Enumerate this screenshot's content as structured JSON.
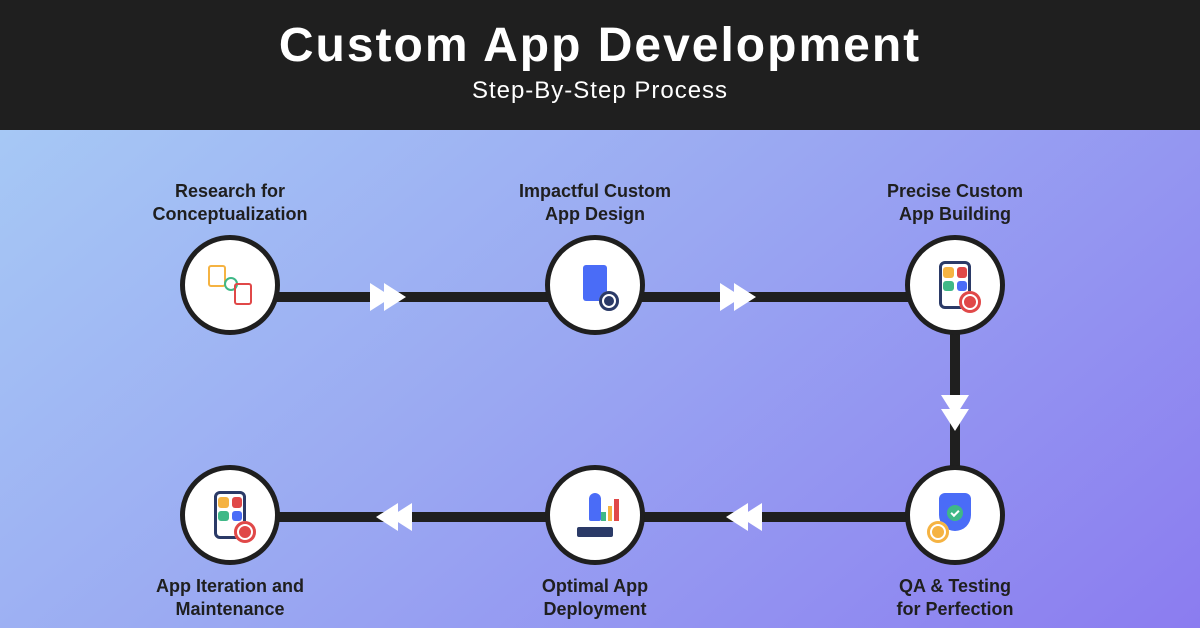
{
  "header": {
    "title": "Custom App Development",
    "subtitle": "Step-By-Step Process"
  },
  "steps": [
    {
      "label": "Research for\nConceptualization",
      "icon": "research-icon"
    },
    {
      "label": "Impactful Custom\nApp Design",
      "icon": "design-icon"
    },
    {
      "label": "Precise Custom\nApp Building",
      "icon": "build-icon"
    },
    {
      "label": "QA & Testing\nfor Perfection",
      "icon": "qa-icon"
    },
    {
      "label": "Optimal App\nDeployment",
      "icon": "deploy-icon"
    },
    {
      "label": "App Iteration and\nMaintenance",
      "icon": "maintain-icon"
    }
  ]
}
